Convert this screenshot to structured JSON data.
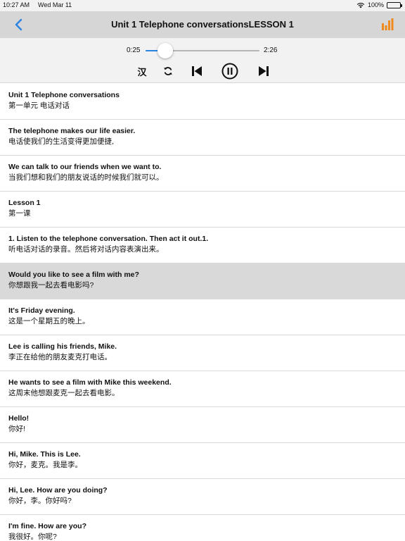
{
  "status_bar": {
    "time": "10:27 AM",
    "date": "Wed Mar 11",
    "battery": "100%"
  },
  "nav": {
    "title": "Unit 1 Telephone conversationsLESSON 1",
    "back_icon": "chevron-left-icon",
    "right_icon": "bar-chart-icon"
  },
  "player": {
    "current_time": "0:25",
    "total_time": "2:26",
    "progress": 0.171,
    "translate_label": "汉",
    "accent_color": "#2a83e0"
  },
  "sentences": [
    {
      "en": "Unit 1 Telephone conversations",
      "zh": "第一单元 电话对话",
      "selected": false
    },
    {
      "en": "The telephone makes our life easier.",
      "zh": "电话使我们的生活变得更加便捷,",
      "selected": false
    },
    {
      "en": "We can talk to our friends when we want to.",
      "zh": "当我们想和我们的朋友说话的时候我们就可以。",
      "selected": false
    },
    {
      "en": "Lesson 1",
      "zh": "第一课",
      "selected": false
    },
    {
      "en": "1. Listen to the telephone conversation. Then act it out.1.",
      "zh": "听电话对话的录音。然后将对话内容表演出来。",
      "selected": false
    },
    {
      "en": "Would you like to see a film with me?",
      "zh": "你想跟我一起去看电影吗?",
      "selected": true
    },
    {
      "en": "It's Friday evening.",
      "zh": "这是一个星期五的晚上。",
      "selected": false
    },
    {
      "en": "Lee is calling his friends, Mike.",
      "zh": "李正在给他的朋友麦克打电话。",
      "selected": false
    },
    {
      "en": "He wants to see a film with Mike this weekend.",
      "zh": "这周末他想跟麦克一起去看电影。",
      "selected": false
    },
    {
      "en": "Hello!",
      "zh": "你好!",
      "selected": false
    },
    {
      "en": "Hi, Mike. This is Lee.",
      "zh": "你好，麦克。我是李。",
      "selected": false
    },
    {
      "en": "Hi, Lee. How are you doing?",
      "zh": "你好，李。你好吗?",
      "selected": false
    },
    {
      "en": "I'm fine. How are you?",
      "zh": "我很好。你呢?",
      "selected": false
    }
  ]
}
